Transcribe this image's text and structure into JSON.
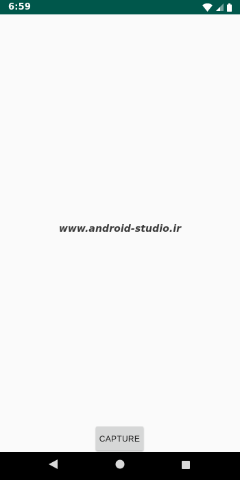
{
  "status_bar": {
    "time": "6:59",
    "icons": [
      "wifi-icon",
      "signal-icon",
      "battery-icon"
    ],
    "background_color": "#00574b"
  },
  "content": {
    "watermark_text": "www.android-studio.ir",
    "background_color": "#fafafa"
  },
  "capture_button": {
    "label": "CAPTURE"
  },
  "nav_bar": {
    "buttons": [
      "back-icon",
      "home-icon",
      "recents-icon"
    ]
  }
}
